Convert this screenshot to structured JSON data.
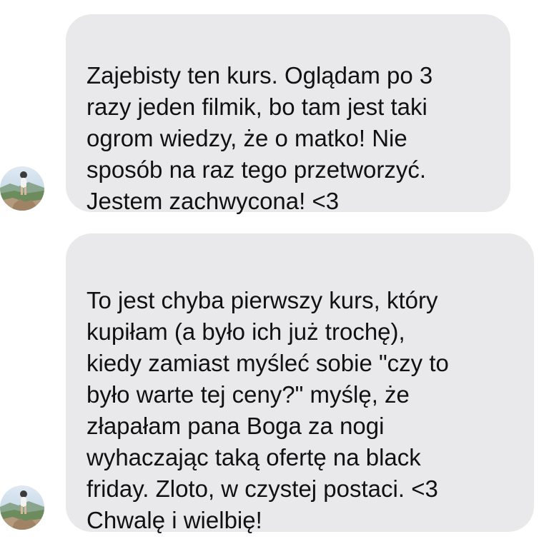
{
  "messages": [
    {
      "sender_avatar": "user-avatar-photo",
      "text": "Zajebisty ten kurs. Oglądam po 3\nrazy jeden filmik, bo tam jest taki\nogrom wiedzy, że o matko! Nie\nsposób na raz tego przetworzyć.\nJestem zachwycona! <3"
    },
    {
      "sender_avatar": "user-avatar-photo",
      "text": "To jest chyba pierwszy kurs, który\nkupiłam (a było ich już trochę),\nkiedy zamiast myśleć sobie \"czy to\nbyło warte tej ceny?\" myślę, że\nzłapałam pana Boga za nogi\nwyhaczając taką ofertę na black\nfriday. Zloto, w czystej postaci. <3\nChwalę i wielbię!"
    }
  ],
  "colors": {
    "bubble_background": "#e9e9eb",
    "text": "#111111",
    "page_background": "#ffffff"
  }
}
